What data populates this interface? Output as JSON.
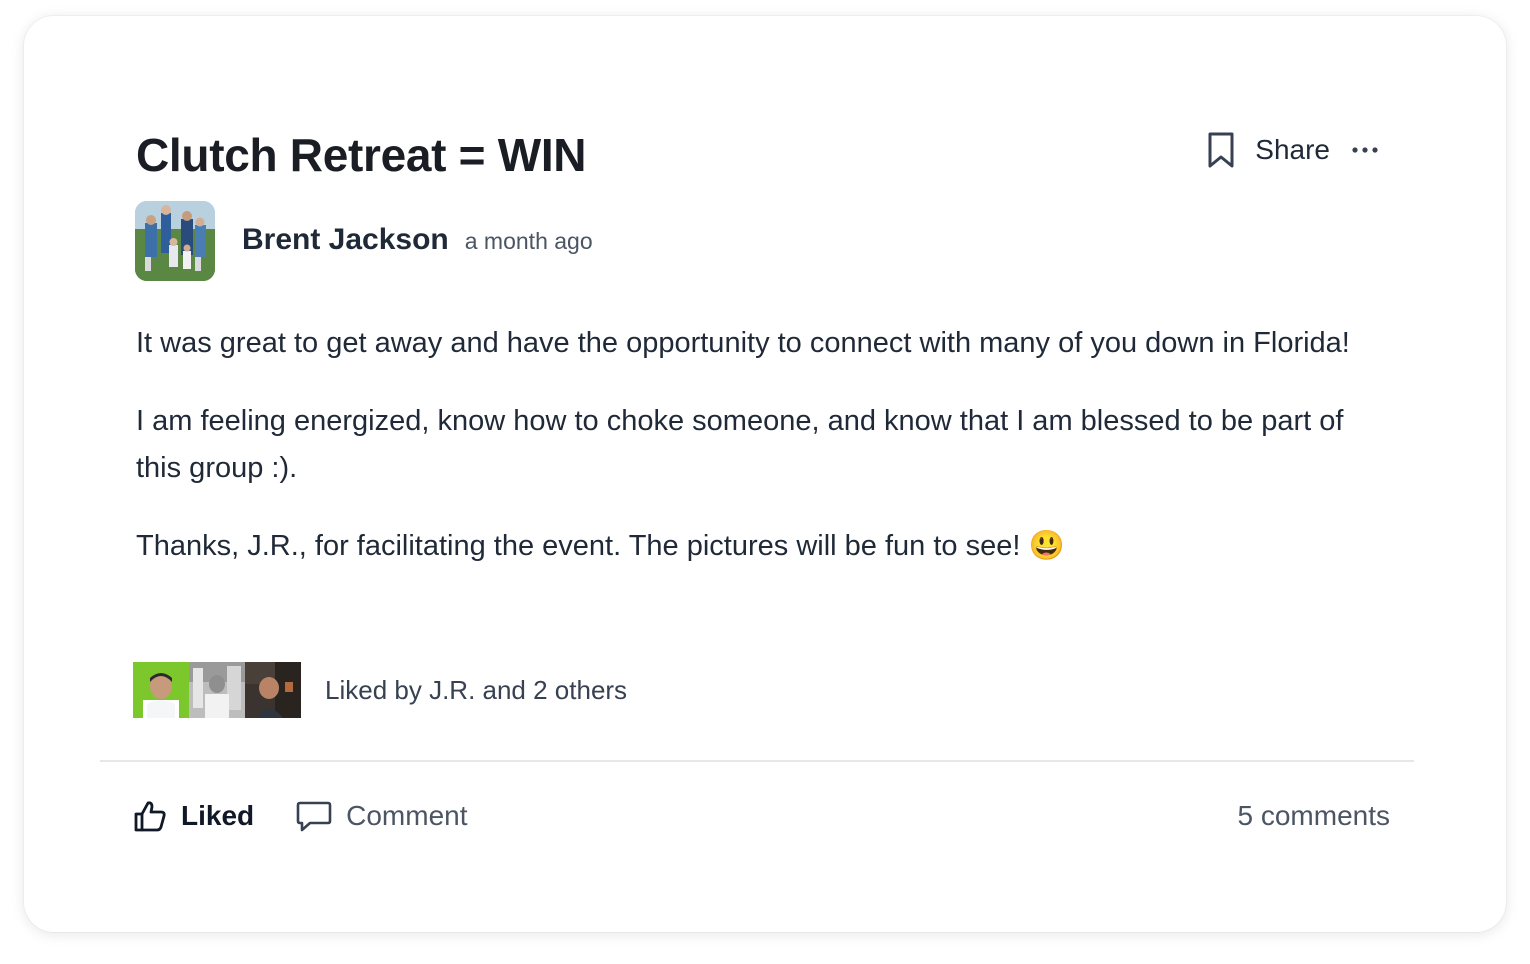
{
  "post": {
    "title": "Clutch Retreat = WIN",
    "share_label": "Share",
    "author": {
      "name": "Brent Jackson",
      "timestamp": "a month ago"
    },
    "body": [
      "It was great to get away and have the opportunity to connect with many of you down in Florida!",
      "I am feeling energized, know how to choke someone, and know that I am blessed to be part of this group :).",
      "Thanks, J.R., for facilitating the event.  The pictures will be fun to see! 😃"
    ],
    "likes_text": "Liked by J.R. and 2 others",
    "actions": {
      "liked_label": "Liked",
      "comment_label": "Comment",
      "comments_count": "5 comments"
    },
    "icons": [
      "bookmark-icon",
      "more-icon",
      "thumbs-up-icon",
      "comment-icon"
    ],
    "colors": {
      "text": "#1f2937",
      "muted": "#4b5563",
      "divider": "#e5e7eb",
      "liker_1_bg": "#7cc72b"
    }
  }
}
